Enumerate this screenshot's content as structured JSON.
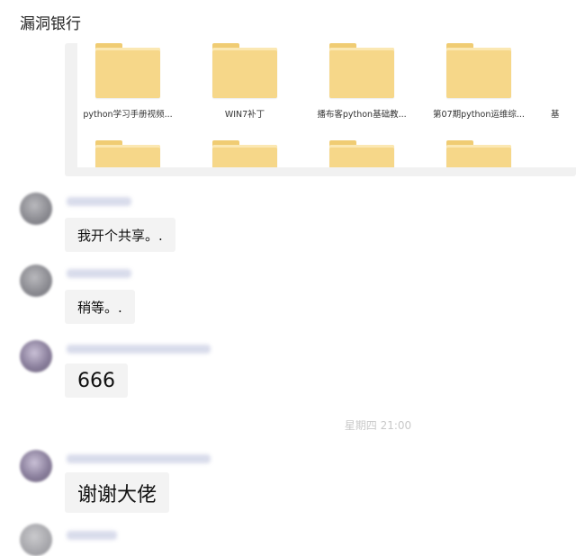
{
  "chat": {
    "title": "漏洞银行"
  },
  "shared_folders": {
    "row1": [
      {
        "label": "python学习手册视频..."
      },
      {
        "label": "WIN7补丁"
      },
      {
        "label": "播布客python基础教..."
      },
      {
        "label": "第07期python运维综..."
      }
    ],
    "edge_label": "基"
  },
  "messages": [
    {
      "text": "我开个共享。."
    },
    {
      "text": "稍等。."
    },
    {
      "text": "666"
    },
    {
      "text": "谢谢大佬"
    }
  ],
  "timestamp": "星期四  21:00",
  "colors": {
    "folder": "#f6d789",
    "bubble": "#f3f3f3",
    "panel": "#f1f1f1",
    "timestamp": "#c9c9c9"
  }
}
